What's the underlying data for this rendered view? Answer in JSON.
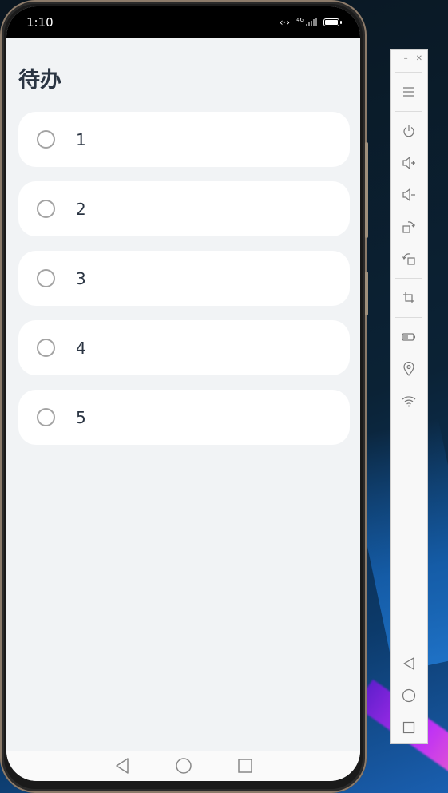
{
  "status_bar": {
    "time": "1:10",
    "network_label": "4G"
  },
  "app": {
    "title": "待办"
  },
  "todos": [
    {
      "label": "1",
      "checked": false
    },
    {
      "label": "2",
      "checked": false
    },
    {
      "label": "3",
      "checked": false
    },
    {
      "label": "4",
      "checked": false
    },
    {
      "label": "5",
      "checked": false
    }
  ],
  "system_nav": [
    "back-icon",
    "home-icon",
    "recents-icon"
  ],
  "side_panel": {
    "buttons": [
      "menu-icon",
      "power-icon",
      "volume-up-icon",
      "volume-down-icon",
      "rotate-right-icon",
      "rotate-left-icon",
      "crop-icon",
      "battery-icon",
      "location-icon",
      "wifi-icon"
    ],
    "nav_buttons": [
      "back-icon",
      "home-icon",
      "recents-icon"
    ]
  },
  "colors": {
    "screen_bg": "#f1f3f5",
    "card_bg": "#ffffff",
    "text": "#2a3442",
    "radio_border": "#a3a3a3"
  }
}
